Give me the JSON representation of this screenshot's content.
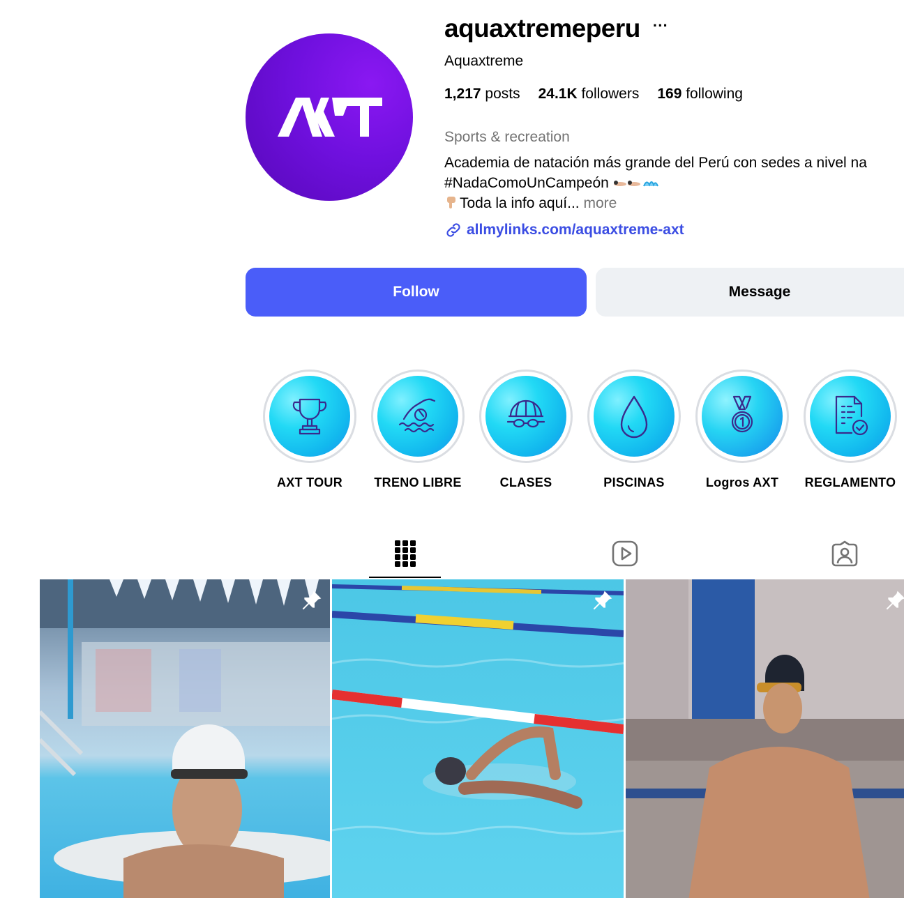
{
  "profile": {
    "username": "aquaxtremeperu",
    "more_label": "···",
    "full_name": "Aquaxtreme",
    "avatar_text": "AXT",
    "stats": {
      "posts_count": "1,217",
      "posts_label": " posts",
      "followers_count": "24.1K",
      "followers_label": " followers",
      "following_count": "169",
      "following_label": " following"
    },
    "category": "Sports & recreation",
    "bio_line1": "Academia de natación más grande del Perú con sedes a nivel na",
    "bio_line2": "#NadaComoUnCampeón",
    "bio_line3": "Toda la info aquí...",
    "bio_more": "more",
    "link": "allmylinks.com/aquaxtreme-axt"
  },
  "actions": {
    "follow": "Follow",
    "message": "Message"
  },
  "highlights": [
    {
      "label": "AXT TOUR",
      "icon": "trophy-icon"
    },
    {
      "label": "TRENO LIBRE",
      "icon": "swimmer-icon"
    },
    {
      "label": "CLASES",
      "icon": "swim-cap-goggles-icon"
    },
    {
      "label": "PISCINAS",
      "icon": "water-drop-icon"
    },
    {
      "label": "Logros AXT",
      "icon": "medal-icon"
    },
    {
      "label": "REGLAMENTO",
      "icon": "document-check-icon"
    }
  ],
  "tabs": [
    {
      "name": "posts",
      "icon": "grid-icon",
      "active": true
    },
    {
      "name": "reels",
      "icon": "reels-icon",
      "active": false
    },
    {
      "name": "tagged",
      "icon": "tagged-icon",
      "active": false
    }
  ],
  "posts": [
    {
      "subject": "woman in white swim cap resting at pool edge",
      "pinned": true
    },
    {
      "subject": "swimmer doing freestyle in lane",
      "pinned": true
    },
    {
      "subject": "man in black swim cap and gold goggles standing",
      "pinned": true
    }
  ],
  "colors": {
    "accent": "#4a5df9",
    "link": "#3b4de3",
    "avatar_purple": "#6f10de",
    "highlight_cyan": "#22d9f5",
    "muted_text": "#737373"
  }
}
